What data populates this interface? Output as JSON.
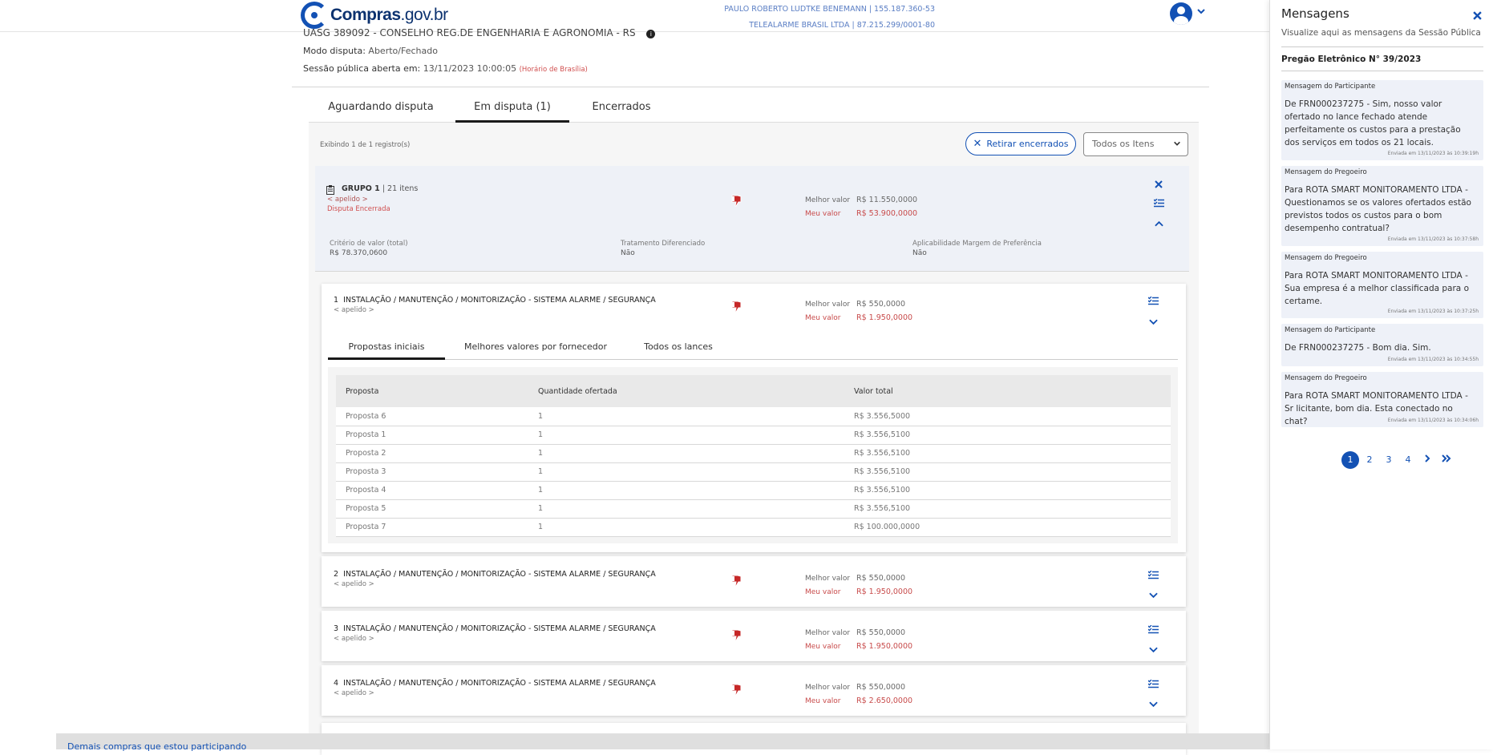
{
  "header": {
    "logo_text_a": "Compras",
    "logo_text_b": ".gov.br",
    "user_line1": "PAULO ROBERTO LUDTKE BENEMANN | 155.187.360-53",
    "user_line2": "TELEALARME BRASIL LTDA | 87.215.299/0001-80"
  },
  "info": {
    "uasg": "UASG 389092 - CONSELHO REG.DE ENGENHARIA E AGRONOMIA - RS",
    "modo_label": "Modo disputa:",
    "modo_value": "Aberto/Fechado",
    "sessao_label": "Sessão pública aberta em:",
    "sessao_value": "13/11/2023 10:00:05",
    "sessao_note": "(Horário de Brasília)"
  },
  "tabs": [
    "Aguardando disputa",
    "Em disputa (1)",
    "Encerrados"
  ],
  "toolbar": {
    "records": "Exibindo 1 de 1 registro(s)",
    "retirar": "Retirar encerrados",
    "filter": "Todos os Itens"
  },
  "group": {
    "title": "GRUPO 1",
    "count": "| 21 itens",
    "apelido": "< apelido >",
    "status": "Disputa Encerrada",
    "melhor_label": "Melhor valor",
    "melhor_value": "R$ 11.550,0000",
    "meu_label": "Meu valor",
    "meu_value": "R$ 53.900,0000",
    "criterio_label": "Critério de valor (total)",
    "criterio_value": "R$ 78.370,0600",
    "tratamento_label": "Tratamento Diferenciado",
    "tratamento_value": "Não",
    "margem_label": "Aplicabilidade Margem de Preferência",
    "margem_value": "Não"
  },
  "items": [
    {
      "num": "1",
      "title": "INSTALAÇÃO / MANUTENÇÃO / MONITORIZAÇÃO - SISTEMA ALARME / SEGURANÇA",
      "apelido": "< apelido >",
      "melhor_label": "Melhor valor",
      "melhor": "R$ 550,0000",
      "meu_label": "Meu valor",
      "meu": "R$ 1.950,0000"
    },
    {
      "num": "2",
      "title": "INSTALAÇÃO / MANUTENÇÃO / MONITORIZAÇÃO - SISTEMA ALARME / SEGURANÇA",
      "apelido": "< apelido >",
      "melhor_label": "Melhor valor",
      "melhor": "R$ 550,0000",
      "meu_label": "Meu valor",
      "meu": "R$ 1.950,0000"
    },
    {
      "num": "3",
      "title": "INSTALAÇÃO / MANUTENÇÃO / MONITORIZAÇÃO - SISTEMA ALARME / SEGURANÇA",
      "apelido": "< apelido >",
      "melhor_label": "Melhor valor",
      "melhor": "R$ 550,0000",
      "meu_label": "Meu valor",
      "meu": "R$ 1.950,0000"
    },
    {
      "num": "4",
      "title": "INSTALAÇÃO / MANUTENÇÃO / MONITORIZAÇÃO - SISTEMA ALARME / SEGURANÇA",
      "apelido": "< apelido >",
      "melhor_label": "Melhor valor",
      "melhor": "R$ 550,0000",
      "meu_label": "Meu valor",
      "meu": "R$ 2.650,0000"
    }
  ],
  "subtabs": [
    "Propostas iniciais",
    "Melhores valores por fornecedor",
    "Todos os lances"
  ],
  "proposals": {
    "headers": [
      "Proposta",
      "Quantidade ofertada",
      "Valor total"
    ],
    "rows": [
      [
        "Proposta 6",
        "1",
        "R$ 3.556,5000"
      ],
      [
        "Proposta 1",
        "1",
        "R$ 3.556,5100"
      ],
      [
        "Proposta 2",
        "1",
        "R$ 3.556,5100"
      ],
      [
        "Proposta 3",
        "1",
        "R$ 3.556,5100"
      ],
      [
        "Proposta 4",
        "1",
        "R$ 3.556,5100"
      ],
      [
        "Proposta 5",
        "1",
        "R$ 3.556,5100"
      ],
      [
        "Proposta 7",
        "1",
        "R$ 100.000,0000"
      ]
    ]
  },
  "sidebar": {
    "title": "Mensagens",
    "subtitle": "Visualize aqui as mensagens da Sessão Pública",
    "pregao": "Pregão Eletrônico N° 39/2023",
    "messages": [
      {
        "head": "Mensagem do Participante",
        "body": "De FRN000237275 - Sim, nosso valor ofertado no lance fechado atende perfeitamente os custos para a prestação dos serviços em todos os 21 locais.",
        "time": "Enviada em 13/11/2023 às 10:39:19h"
      },
      {
        "head": "Mensagem do Pregoeiro",
        "body": "Para ROTA SMART MONITORAMENTO LTDA - Questionamos se os valores ofertados estão previstos todos os custos para o bom desempenho contratual?",
        "time": "Enviada em 13/11/2023 às 10:37:58h"
      },
      {
        "head": "Mensagem do Pregoeiro",
        "body": "Para ROTA SMART MONITORAMENTO LTDA - Sua empresa é a melhor classificada para o certame.",
        "time": "Enviada em 13/11/2023 às 10:37:25h"
      },
      {
        "head": "Mensagem do Participante",
        "body": "De FRN000237275 - Bom dia. Sim.",
        "time": "Enviada em 13/11/2023 às 10:34:55h"
      },
      {
        "head": "Mensagem do Pregoeiro",
        "body": "Para ROTA SMART MONITORAMENTO LTDA - Sr licitante, bom dia. Esta conectado no chat?",
        "time": "Enviada em 13/11/2023 às 10:34:06h"
      }
    ],
    "pages": [
      "1",
      "2",
      "3",
      "4"
    ]
  },
  "footer": {
    "text": "Demais compras que estou participando"
  },
  "colors": {
    "accent": "#1351b4",
    "danger": "#c84b4b"
  }
}
